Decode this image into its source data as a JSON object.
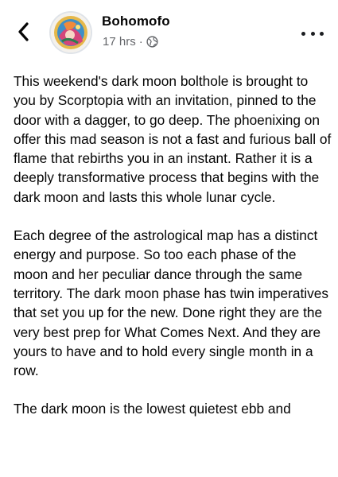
{
  "post": {
    "author": "Bohomofo",
    "time": "17 hrs",
    "separator": "·",
    "privacy_icon": "globe-icon",
    "paragraphs": [
      "This weekend's dark moon bolthole is brought to you by Scorptopia with an invitation, pinned to the door with a dagger, to go deep. The phoenixing on offer this mad season is not a fast and furious ball of flame that rebirths you in an instant. Rather it is a deeply transformative process that begins with the dark moon and lasts this whole lunar cycle.",
      "Each degree of the astrological map has a distinct energy and purpose. So too each phase of the moon and her peculiar dance through the same territory. The dark moon phase has twin imperatives that set you up for the new. Done right they are the very best prep for What Comes Next. And they are yours to have and to hold every single month in a row.",
      "The dark moon is the lowest quietest ebb and"
    ]
  },
  "icons": {
    "back": "chevron-left-icon",
    "more": "more-options-icon"
  },
  "colors": {
    "text": "#050505",
    "secondary_text": "#65676b"
  }
}
